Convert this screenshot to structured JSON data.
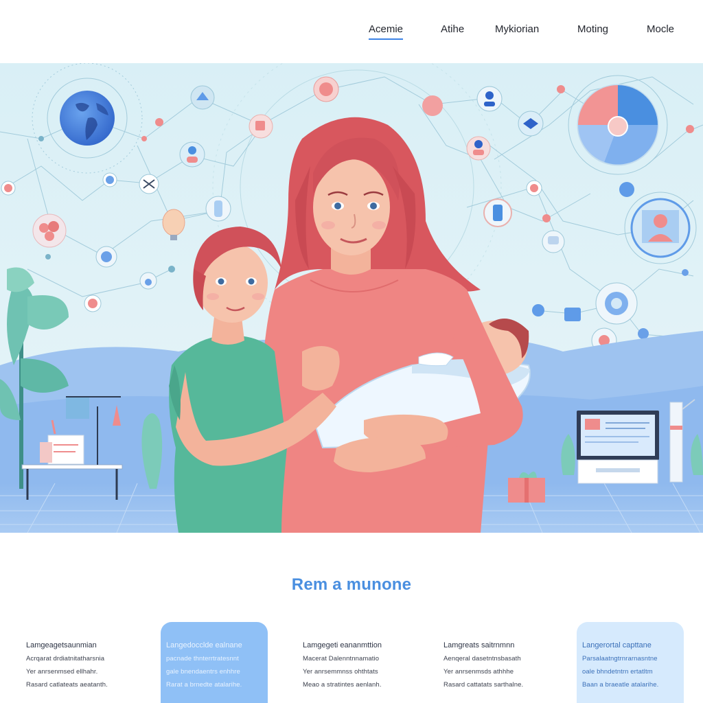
{
  "nav": {
    "items": [
      {
        "label": "Acemie",
        "active": true
      },
      {
        "label": "Atihe",
        "active": false
      },
      {
        "label": "Mykiorian",
        "active": false
      },
      {
        "label": "Moting",
        "active": false
      },
      {
        "label": "Mocle",
        "active": false
      }
    ]
  },
  "hero": {
    "illustration": "mother-holding-newborn-with-child-network-icons"
  },
  "section": {
    "title": "Rem a munone"
  },
  "cards": [
    {
      "style": "plain",
      "title": "Lamgeagetsaunmian",
      "lines": [
        "Acrqarat drdiatnitatharsnia",
        "Yer anrsenmsed ellhahr.",
        "Rasard catlateats aeatanth."
      ]
    },
    {
      "style": "blue",
      "title": "Langedocclde ealnane",
      "lines": [
        "pacnade thnterrtratesnnt",
        "gale bnendaentrs enhhre",
        "Rarat a brnedte atalarihe."
      ]
    },
    {
      "style": "plain",
      "title": "Lamgegeti eananmttion",
      "lines": [
        "Macerat Dalenntnnamatio",
        "Yer anrsemmnss ohthtats",
        "Meao a stratintes aenlanh."
      ]
    },
    {
      "style": "plain",
      "title": "Lamgreats saitrnmnn",
      "lines": [
        "Aenqeral dasetntnsbasath",
        "Yer anrsenmsds athhhe",
        "Rasard cattatats sarthalne."
      ]
    },
    {
      "style": "lightblue",
      "title": "Langerortal capttane",
      "lines": [
        "Parsalaatngtrnrarnasntne",
        "oale bhndetntrn ertatltm",
        "Baan a braeatle atalarihe."
      ]
    }
  ],
  "colors": {
    "accent": "#3b82e6",
    "title_blue": "#4a8fe0",
    "card_blue": "#8fc0f6",
    "card_lightblue": "#d6eafd",
    "sky": "#dff1f6",
    "mother_top": "#ef8583",
    "child_shirt": "#56b89a"
  }
}
